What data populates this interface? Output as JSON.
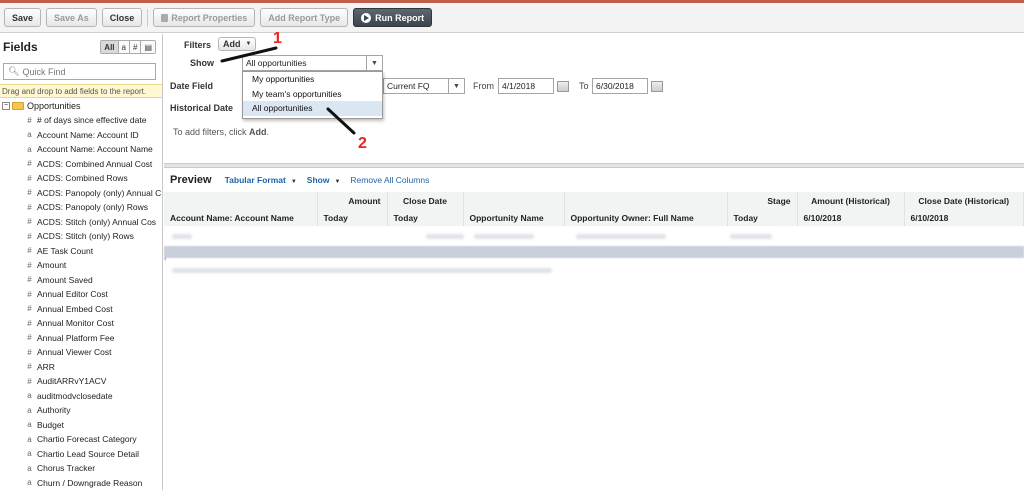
{
  "toolbar": {
    "save": "Save",
    "save_as": "Save As",
    "close": "Close",
    "report_properties": "Report Properties",
    "add_report_type": "Add Report Type",
    "run_report": "Run Report"
  },
  "sidebar": {
    "title": "Fields",
    "segments": [
      "All",
      "a",
      "#",
      "▤"
    ],
    "quick_find_placeholder": "Quick Find",
    "hint": "Drag and drop to add fields to the report.",
    "root": "Opportunities",
    "fields": [
      {
        "icon": "#",
        "label": "# of days since effective date"
      },
      {
        "icon": "a",
        "label": "Account Name: Account ID"
      },
      {
        "icon": "a",
        "label": "Account Name: Account Name"
      },
      {
        "icon": "#",
        "label": "ACDS: Combined Annual Cost"
      },
      {
        "icon": "#",
        "label": "ACDS: Combined Rows"
      },
      {
        "icon": "#",
        "label": "ACDS: Panopoly (only) Annual C"
      },
      {
        "icon": "#",
        "label": "ACDS: Panopoly (only) Rows"
      },
      {
        "icon": "#",
        "label": "ACDS: Stitch (only) Annual Cos"
      },
      {
        "icon": "#",
        "label": "ACDS: Stitch (only) Rows"
      },
      {
        "icon": "#",
        "label": "AE Task Count"
      },
      {
        "icon": "#",
        "label": "Amount"
      },
      {
        "icon": "#",
        "label": "Amount Saved"
      },
      {
        "icon": "#",
        "label": "Annual Editor Cost"
      },
      {
        "icon": "#",
        "label": "Annual Embed Cost"
      },
      {
        "icon": "#",
        "label": "Annual Monitor Cost"
      },
      {
        "icon": "#",
        "label": "Annual Platform Fee"
      },
      {
        "icon": "#",
        "label": "Annual Viewer Cost"
      },
      {
        "icon": "#",
        "label": "ARR"
      },
      {
        "icon": "#",
        "label": "AuditARRvY1ACV"
      },
      {
        "icon": "a",
        "label": "auditmodvclosedate"
      },
      {
        "icon": "a",
        "label": "Authority"
      },
      {
        "icon": "a",
        "label": "Budget"
      },
      {
        "icon": "a",
        "label": "Chartio Forecast Category"
      },
      {
        "icon": "a",
        "label": "Chartio Lead Source Detail"
      },
      {
        "icon": "a",
        "label": "Chorus Tracker"
      },
      {
        "icon": "a",
        "label": "Churn / Downgrade Reason"
      }
    ]
  },
  "filters": {
    "label": "Filters",
    "add_button": "Add",
    "show_label": "Show",
    "show_value": "All opportunities",
    "date_field_label": "Date Field",
    "range_value": "Current FQ",
    "from_label": "From",
    "from_value": "4/1/2018",
    "to_label": "To",
    "to_value": "6/30/2018",
    "historical_label": "Historical Date",
    "empty_hint_prefix": "To add filters, click ",
    "empty_hint_bold": "Add",
    "empty_hint_suffix": ".",
    "dropdown_options": [
      "My opportunities",
      "My team's opportunities",
      "All opportunities"
    ]
  },
  "preview": {
    "title": "Preview",
    "format": "Tabular Format",
    "show": "Show",
    "remove_all": "Remove All Columns",
    "columns": [
      {
        "top": "",
        "bottom": "Account Name: Account Name"
      },
      {
        "top": "Amount",
        "bottom": "Today"
      },
      {
        "top": "Close Date",
        "bottom": "Today"
      },
      {
        "top": "",
        "bottom": "Opportunity Name"
      },
      {
        "top": "",
        "bottom": "Opportunity Owner: Full Name"
      },
      {
        "top": "Stage",
        "bottom": "Today"
      },
      {
        "top": "Amount (Historical)",
        "bottom": "6/10/2018"
      },
      {
        "top": "Close Date (Historical)",
        "bottom": "6/10/2018"
      }
    ]
  },
  "annotations": {
    "one": "1",
    "two": "2"
  },
  "colors": {
    "accent_red": "#e8241e",
    "link_blue": "#1f63a8",
    "highlight": "#dbe6f3"
  }
}
